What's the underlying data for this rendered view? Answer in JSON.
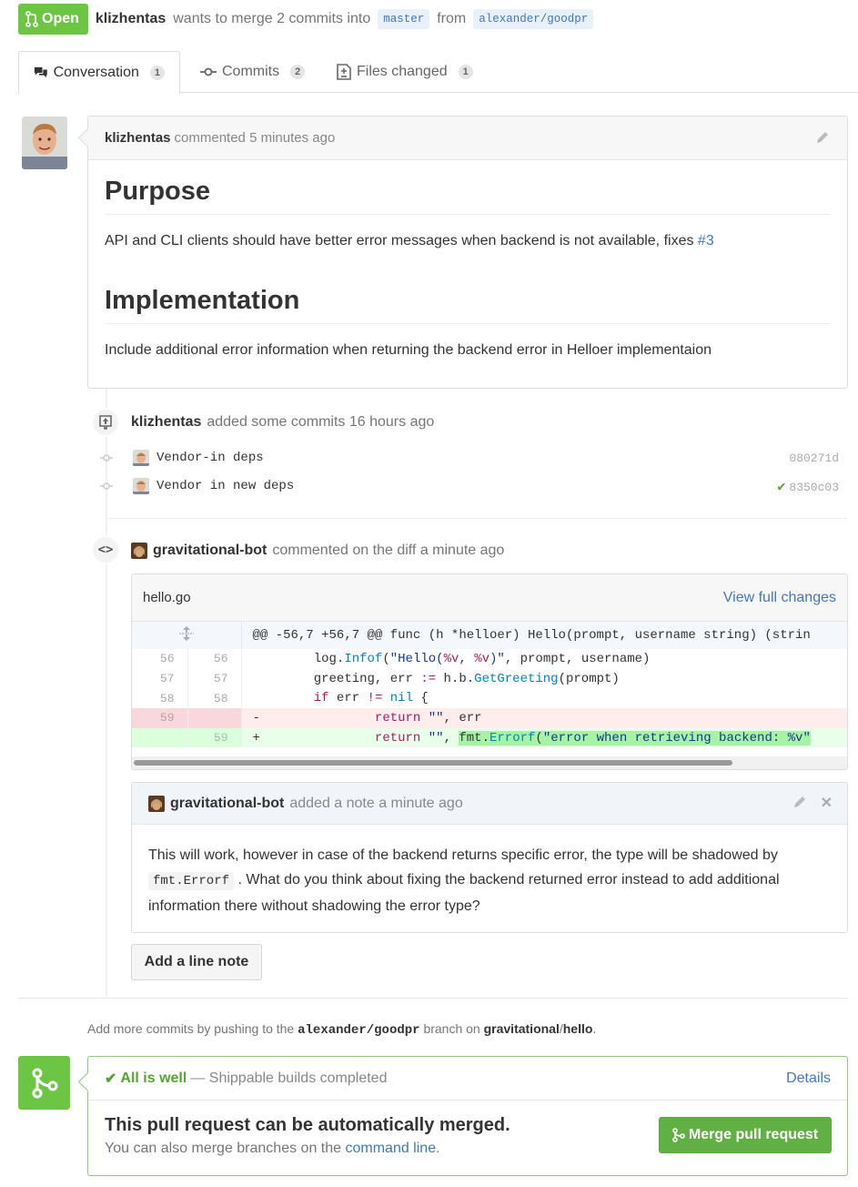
{
  "header": {
    "state": "Open",
    "author": "klizhentas",
    "action": "wants to merge 2 commits into",
    "base_branch": "master",
    "from_text": "from",
    "head_branch": "alexander/goodpr"
  },
  "tabs": [
    {
      "label": "Conversation",
      "count": "1"
    },
    {
      "label": "Commits",
      "count": "2"
    },
    {
      "label": "Files changed",
      "count": "1"
    }
  ],
  "comment": {
    "author": "klizhentas",
    "meta": "commented 5 minutes ago",
    "h1": "Purpose",
    "p1": "API and CLI clients should have better error messages when backend is not available, fixes ",
    "issue_link": "#3",
    "h2": "Implementation",
    "p2": "Include additional error information when returning the backend error in Helloer implementaion"
  },
  "commits_event": {
    "author": "klizhentas",
    "meta": "added some commits 16 hours ago",
    "commits": [
      {
        "message": "Vendor-in deps",
        "sha": "080271d",
        "status": ""
      },
      {
        "message": "Vendor in new deps",
        "sha": "8350c03",
        "status": "success"
      }
    ]
  },
  "diff_event": {
    "author": "gravitational-bot",
    "meta": "commented on the diff a minute ago"
  },
  "file": {
    "name": "hello.go",
    "view_full": "View full changes",
    "hunk": "@@ -56,7 +56,7 @@ func (h *helloer) Hello(prompt, username string) (strin",
    "lines": [
      {
        "old": "56",
        "new": "56",
        "type": "ctx"
      },
      {
        "old": "57",
        "new": "57",
        "type": "ctx"
      },
      {
        "old": "58",
        "new": "58",
        "type": "ctx"
      },
      {
        "old": "59",
        "new": "",
        "type": "del"
      },
      {
        "old": "",
        "new": "59",
        "type": "add"
      }
    ]
  },
  "note": {
    "author": "gravitational-bot",
    "meta": "added a note a minute ago",
    "text1": "This will work, however in case of the backend returns specific error, the type will be shadowed by",
    "code": "fmt.Errorf",
    "text2": ". What do you think about fixing the backend returned error instead to add additional information there without shadowing the error type?"
  },
  "add_line_note": "Add a line note",
  "push_hint": {
    "prefix": "Add more commits by pushing to the",
    "branch": "alexander/goodpr",
    "mid": "branch on",
    "owner": "gravitational",
    "slash": "/",
    "repo": "hello",
    "dot": "."
  },
  "merge": {
    "status": "All is well",
    "status_desc": "— Shippable builds completed",
    "details": "Details",
    "title": "This pull request can be automatically merged.",
    "sub_prefix": "You can also merge branches on the",
    "sub_link": "command line",
    "sub_suffix": ".",
    "button": "Merge pull request"
  },
  "colors": {
    "open_green": "#6cc644",
    "link_blue": "#4078c0",
    "success": "#55a532"
  },
  "icons": [
    "pull-request-icon",
    "comment-icon",
    "commit-icon",
    "file-diff-icon",
    "pencil-icon",
    "push-icon",
    "code-icon",
    "expand-icon",
    "close-icon",
    "check-icon",
    "merge-icon"
  ]
}
